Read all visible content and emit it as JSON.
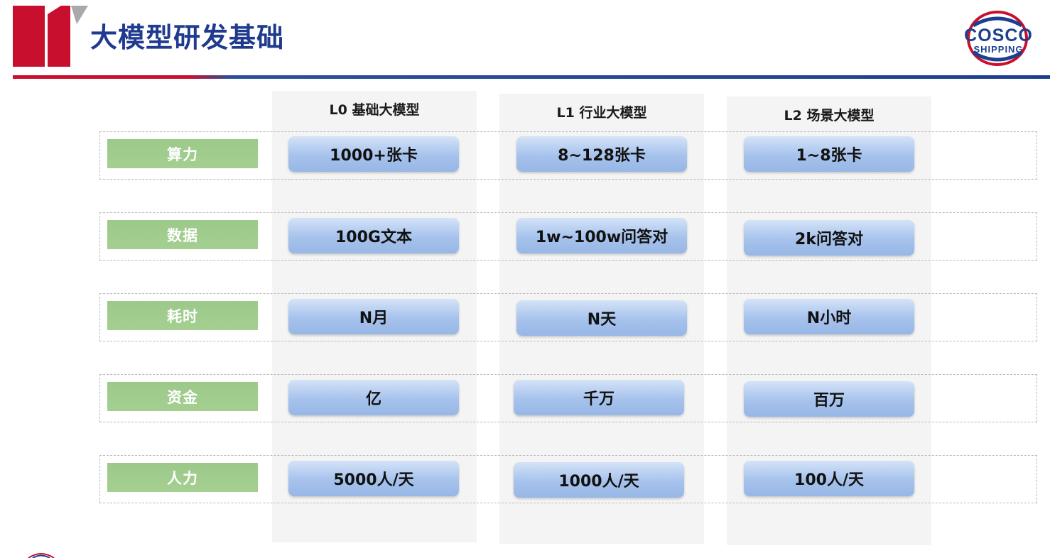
{
  "header": {
    "title": "大模型研发基础",
    "logo_text_top": "COSCO",
    "logo_text_bottom": "SHIPPING"
  },
  "columns": [
    {
      "label": "L0 基础大模型"
    },
    {
      "label": "L1 行业大模型"
    },
    {
      "label": "L2 场景大模型"
    }
  ],
  "rows": [
    {
      "label": "算力",
      "cells": [
        "1000+张卡",
        "8~128张卡",
        "1~8张卡"
      ]
    },
    {
      "label": "数据",
      "cells": [
        "100G文本",
        "1w~100w问答对",
        "2k问答对"
      ]
    },
    {
      "label": "耗时",
      "cells": [
        "N月",
        "N天",
        "N小时"
      ]
    },
    {
      "label": "资金",
      "cells": [
        "亿",
        "千万",
        "百万"
      ]
    },
    {
      "label": "人力",
      "cells": [
        "5000人/天",
        "1000人/天",
        "100人/天"
      ]
    }
  ],
  "colors": {
    "title": "#1f3a8e",
    "brand_red": "#c8102e",
    "brand_blue": "#1d3f8f",
    "row_label_green": "#a1cc8e",
    "cell_blue": "#a6c2ec"
  }
}
